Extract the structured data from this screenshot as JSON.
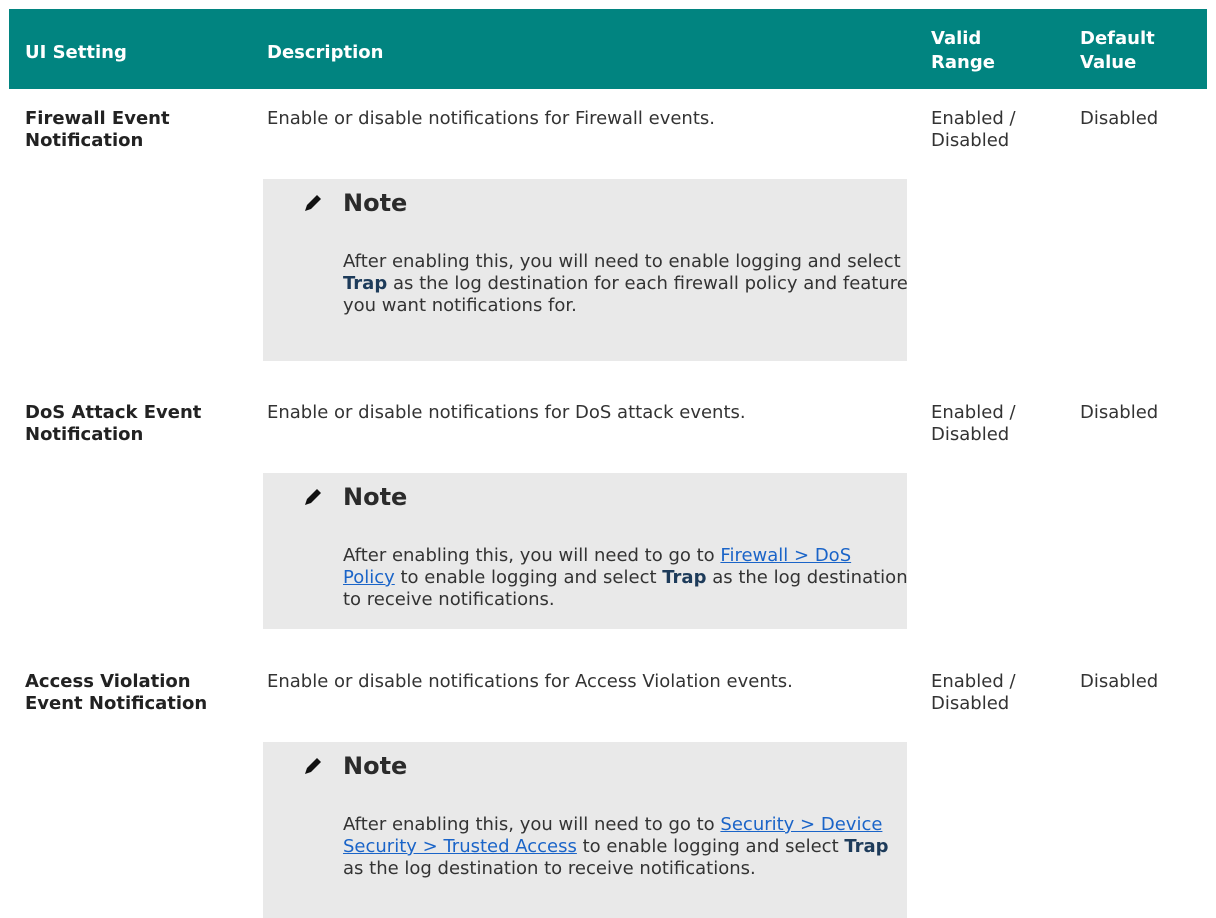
{
  "header": {
    "ui_setting": "UI Setting",
    "description": "Description",
    "valid_range": "Valid Range",
    "default_value": "Default Value"
  },
  "rows": [
    {
      "setting": "Firewall Event Notification",
      "description": "Enable or disable notifications for Firewall events.",
      "valid_range": "Enabled / Disabled",
      "default_value": "Disabled",
      "note": {
        "title": "Note",
        "icon": "pencil-icon",
        "text_1": "After enabling this, you will need to enable logging and select ",
        "bold": "Trap",
        "text_2": " as the log destination for each firewall policy and feature you want notifications for."
      }
    },
    {
      "setting": "DoS Attack Event Notification",
      "description": "Enable or disable notifications for DoS attack events.",
      "valid_range": "Enabled / Disabled",
      "default_value": "Disabled",
      "note": {
        "title": "Note",
        "icon": "pencil-icon",
        "text_1": "After enabling this, you will need to go to ",
        "link": "Firewall > DoS Policy",
        "text_2": " to enable logging and select ",
        "bold": "Trap",
        "text_3": " as the log destination to receive notifications."
      }
    },
    {
      "setting": "Access Violation Event Notification",
      "description": "Enable or disable notifications for Access Violation events.",
      "valid_range": "Enabled / Disabled",
      "default_value": "Disabled",
      "note": {
        "title": "Note",
        "icon": "pencil-icon",
        "text_1": "After enabling this, you will need to go to ",
        "link": "Security > Device Security > Trusted Access",
        "text_2": " to enable logging and select ",
        "bold": "Trap",
        "text_3": " as the log destination to receive notifications."
      }
    }
  ],
  "colors": {
    "header_bg": "#018480",
    "note_bg": "#e9e9e9",
    "link": "#1a64c8"
  }
}
